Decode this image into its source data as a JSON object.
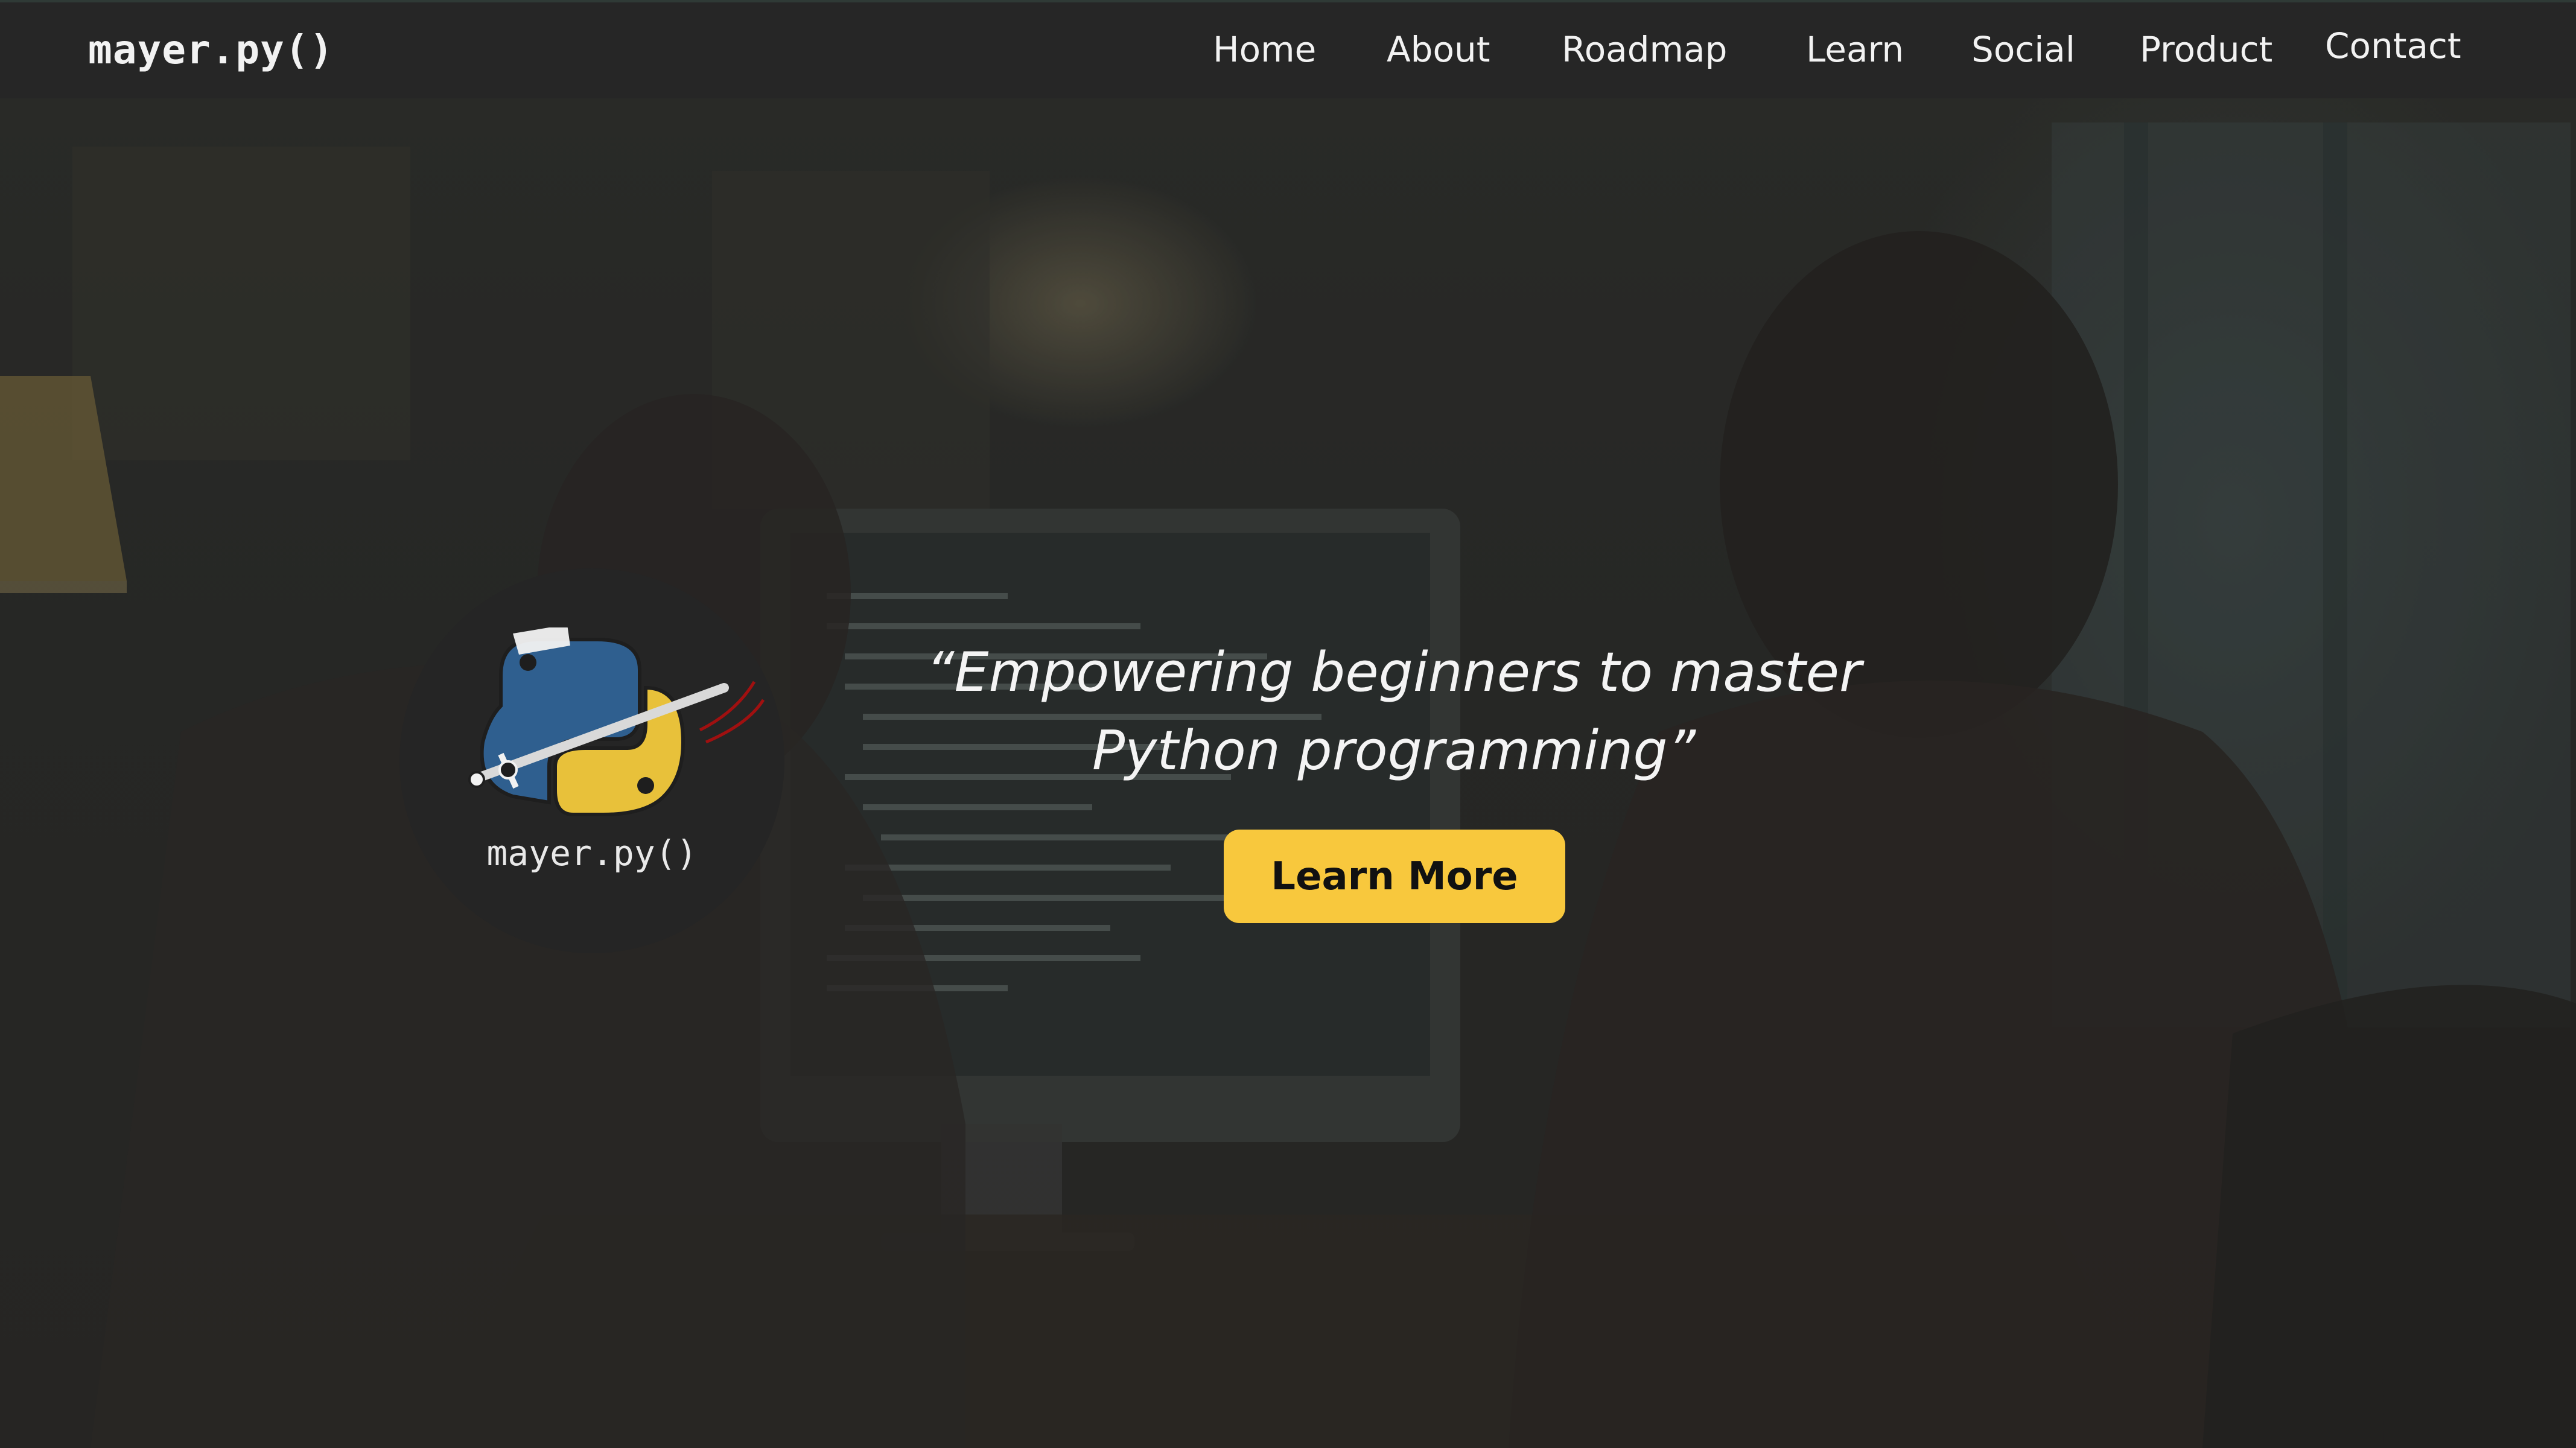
{
  "brand": {
    "name": "mayer.py()"
  },
  "nav": {
    "items": [
      {
        "label": "Home"
      },
      {
        "label": "About"
      },
      {
        "label": "Roadmap"
      },
      {
        "label": "Learn"
      },
      {
        "label": "Social"
      },
      {
        "label": "Product"
      },
      {
        "label": "Contact"
      }
    ]
  },
  "hero": {
    "logo_text": "mayer.py()",
    "tagline_line1": "“Empowering beginners to master",
    "tagline_line2": "Python programming”",
    "cta_label": "Learn More"
  },
  "colors": {
    "nav_background": "#262626",
    "accent_yellow": "#f8c83d",
    "python_blue": "#2f5f8f",
    "python_yellow": "#e8c13a"
  }
}
